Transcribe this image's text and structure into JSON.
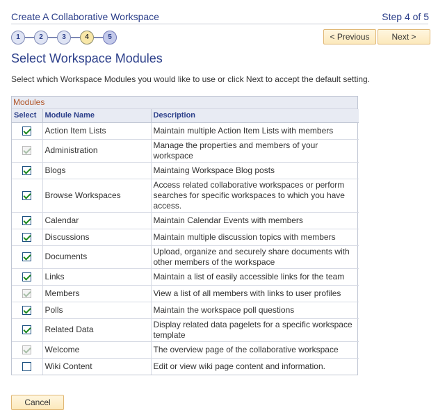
{
  "wizard": {
    "title": "Create A Collaborative Workspace",
    "step_text": "Step 4 of 5",
    "steps": [
      "1",
      "2",
      "3",
      "4",
      "5"
    ],
    "current_step": 4
  },
  "nav": {
    "previous_label": "< Previous",
    "next_label": "Next >"
  },
  "page": {
    "title": "Select Workspace Modules",
    "instructions": "Select which Workspace Modules you would like to use or click Next to accept the default setting."
  },
  "grid": {
    "caption": "Modules",
    "headers": {
      "select": "Select",
      "name": "Module Name",
      "description": "Description"
    },
    "rows": [
      {
        "name": "Action Item Lists",
        "description": "Maintain multiple Action Item Lists with members",
        "checked": true,
        "disabled": false
      },
      {
        "name": "Administration",
        "description": "Manage the properties and members of your workspace",
        "checked": true,
        "disabled": true
      },
      {
        "name": "Blogs",
        "description": "Maintaing Workspace Blog posts",
        "checked": true,
        "disabled": false
      },
      {
        "name": "Browse Workspaces",
        "description": "Access related collaborative workspaces or perform searches for specific workspaces to which you have access.",
        "checked": true,
        "disabled": false
      },
      {
        "name": "Calendar",
        "description": "Maintain Calendar Events with members",
        "checked": true,
        "disabled": false
      },
      {
        "name": "Discussions",
        "description": "Maintain multiple discussion topics with members",
        "checked": true,
        "disabled": false
      },
      {
        "name": "Documents",
        "description": "Upload, organize and securely share documents with other members of the workspace",
        "checked": true,
        "disabled": false
      },
      {
        "name": "Links",
        "description": "Maintain a list of easily accessible links for the team",
        "checked": true,
        "disabled": false
      },
      {
        "name": "Members",
        "description": "View a list of all members with links to user profiles",
        "checked": true,
        "disabled": true
      },
      {
        "name": "Polls",
        "description": "Maintain the workspace poll questions",
        "checked": true,
        "disabled": false
      },
      {
        "name": "Related Data",
        "description": "Display related data pagelets for a specific workspace template",
        "checked": true,
        "disabled": false
      },
      {
        "name": "Welcome",
        "description": "The overview page of the collaborative workspace",
        "checked": true,
        "disabled": true
      },
      {
        "name": "Wiki Content",
        "description": "Edit or view wiki page content and information.",
        "checked": false,
        "disabled": false
      }
    ]
  },
  "footer": {
    "cancel_label": "Cancel"
  }
}
